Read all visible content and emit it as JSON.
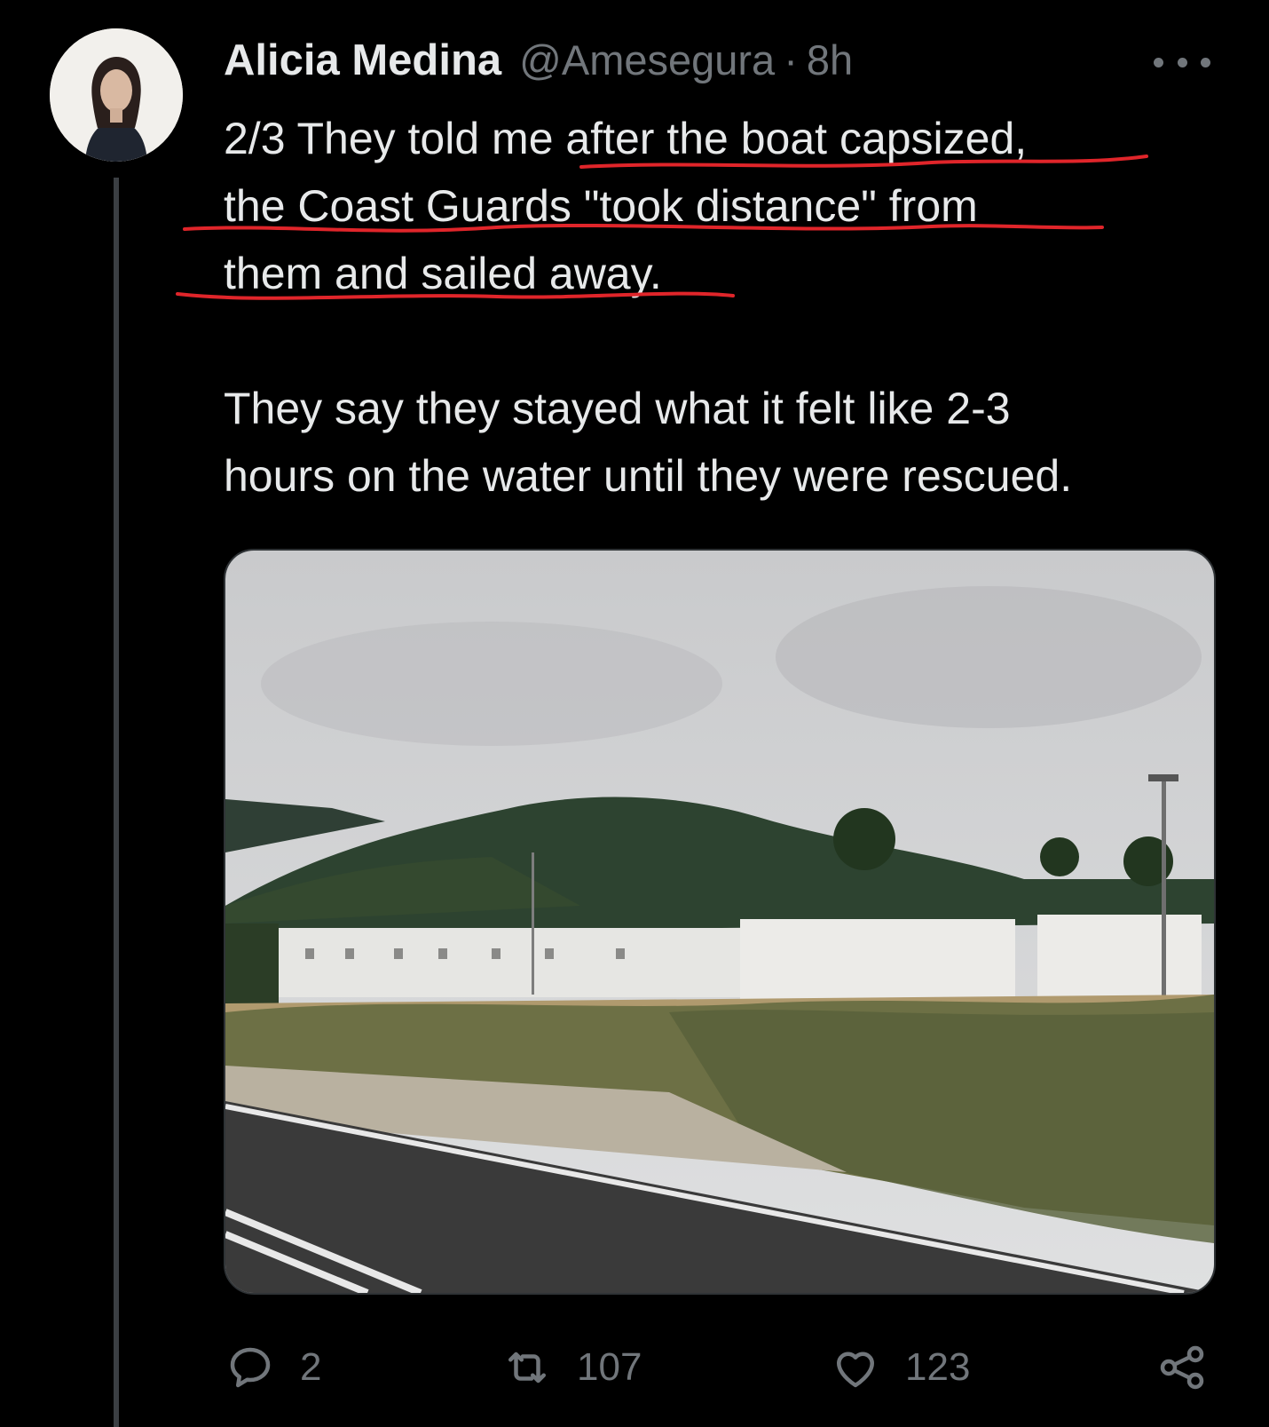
{
  "tweet": {
    "author_name": "Alicia Medina",
    "handle": "@Amesegura",
    "separator": "·",
    "time": "8h",
    "lines": [
      "2/3 They told me after the boat capsized,",
      "the Coast Guards \"took distance\" from",
      "them and sailed away."
    ],
    "paragraph2_lines": [
      "They say they stayed what it felt like 2-3",
      "hours on the water until they were rescued."
    ]
  },
  "icons": {
    "avatar": "avatar",
    "more": "more-options-icon",
    "reply": "reply-icon",
    "retweet": "retweet-icon",
    "like": "heart-icon",
    "share": "share-icon"
  },
  "actions": {
    "replies": "2",
    "retweets": "107",
    "likes": "123"
  },
  "colors": {
    "background": "#000000",
    "text": "#e7e9ea",
    "secondary": "#71767b",
    "underline": "#e0252a"
  }
}
